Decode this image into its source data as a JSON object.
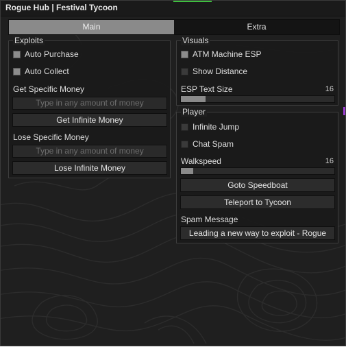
{
  "window": {
    "title": "Rogue Hub | Festival Tycoon"
  },
  "tabs": [
    {
      "label": "Main",
      "active": true
    },
    {
      "label": "Extra",
      "active": false
    }
  ],
  "exploits": {
    "title": "Exploits",
    "auto_purchase": {
      "label": "Auto Purchase",
      "checked": true
    },
    "auto_collect": {
      "label": "Auto Collect",
      "checked": true
    },
    "get_specific_label": "Get Specific Money",
    "get_placeholder": "Type in any amount of money",
    "get_infinite_button": "Get Infinite Money",
    "lose_specific_label": "Lose Specific Money",
    "lose_placeholder": "Type in any amount of money",
    "lose_infinite_button": "Lose Infinite Money"
  },
  "visuals": {
    "title": "Visuals",
    "atm_esp": {
      "label": "ATM Machine ESP",
      "checked": true
    },
    "show_distance": {
      "label": "Show Distance",
      "checked": false
    },
    "esp_text_size": {
      "label": "ESP Text Size",
      "value": "16",
      "fraction": 0.16
    }
  },
  "player": {
    "title": "Player",
    "infinite_jump": {
      "label": "Infinite Jump",
      "checked": false
    },
    "chat_spam": {
      "label": "Chat Spam",
      "checked": false
    },
    "walkspeed": {
      "label": "Walkspeed",
      "value": "16",
      "fraction": 0.08
    },
    "goto_speedboat": "Goto Speedboat",
    "teleport_tycoon": "Teleport to Tycoon",
    "spam_message_label": "Spam Message",
    "spam_message_value": "Leading a new way to exploit - Rogue"
  },
  "colors": {
    "window_bg": "#1f1f1f",
    "accent_green": "#3fbf3f",
    "accent_purple": "#9b3fd0",
    "active_tab": "#8a8a8a",
    "checkbox_on": "#8c8c8c"
  }
}
